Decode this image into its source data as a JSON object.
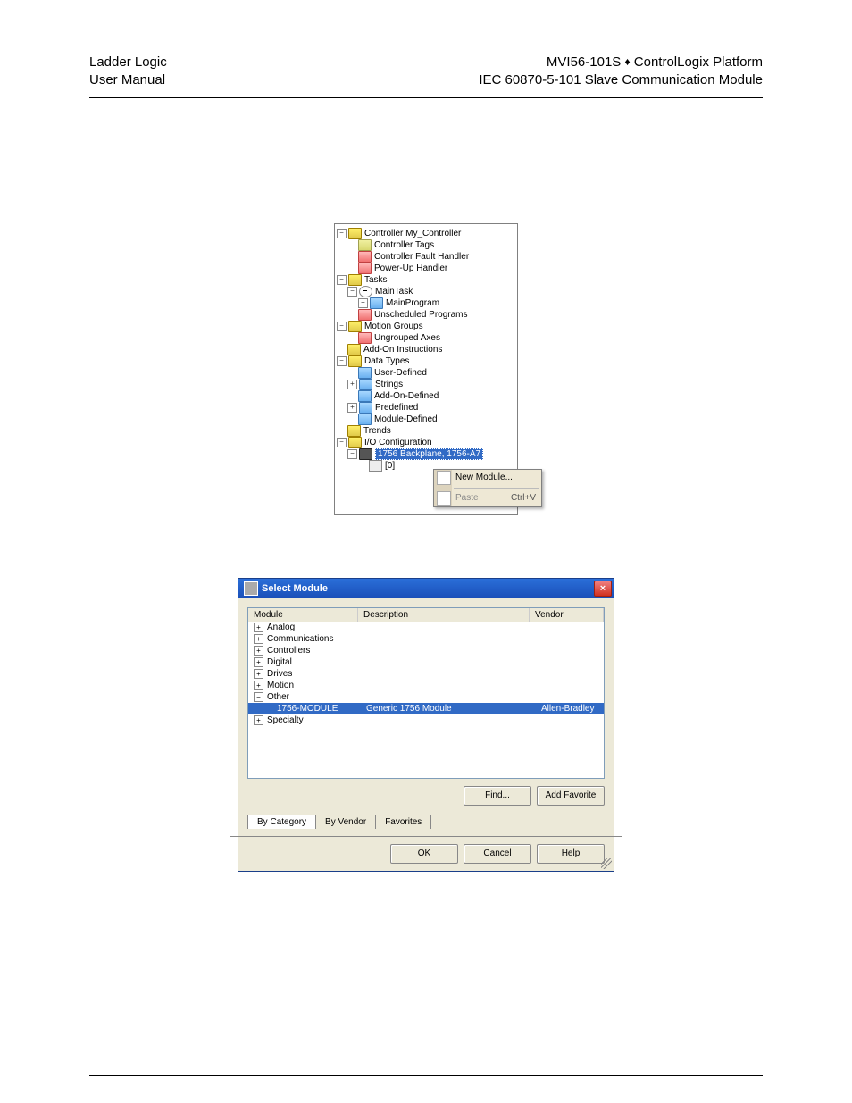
{
  "header": {
    "left1": "Ladder Logic",
    "left2": "User Manual",
    "right1_a": "MVI56-101S",
    "right1_b": "ControlLogix Platform",
    "right2": "IEC 60870-5-101 Slave Communication Module"
  },
  "tree": {
    "controller": "Controller My_Controller",
    "items": [
      "Controller Tags",
      "Controller Fault Handler",
      "Power-Up Handler"
    ],
    "tasks_root": "Tasks",
    "maintask": "MainTask",
    "mainprogram": "MainProgram",
    "unsched": "Unscheduled Programs",
    "motion_groups": "Motion Groups",
    "ungrouped_axes": "Ungrouped Axes",
    "addon": "Add-On Instructions",
    "datatypes_root": "Data Types",
    "dt": [
      "User-Defined",
      "Strings",
      "Add-On-Defined",
      "Predefined",
      "Module-Defined"
    ],
    "trends": "Trends",
    "ioconfig": "I/O Configuration",
    "backplane": "1756 Backplane, 1756-A7",
    "slot0": "[0]",
    "ctx_new": "New Module...",
    "ctx_paste": "Paste",
    "ctx_paste_sc": "Ctrl+V"
  },
  "dlg": {
    "title": "Select Module",
    "col_module": "Module",
    "col_desc": "Description",
    "col_vendor": "Vendor",
    "cats": [
      "Analog",
      "Communications",
      "Controllers",
      "Digital",
      "Drives",
      "Motion",
      "Other"
    ],
    "sel_module": "1756-MODULE",
    "sel_desc": "Generic 1756 Module",
    "sel_vendor": "Allen-Bradley",
    "last_cat": "Specialty",
    "btn_find": "Find...",
    "btn_addfav": "Add Favorite",
    "tab_bycat": "By Category",
    "tab_byvend": "By Vendor",
    "tab_fav": "Favorites",
    "btn_ok": "OK",
    "btn_cancel": "Cancel",
    "btn_help": "Help"
  }
}
